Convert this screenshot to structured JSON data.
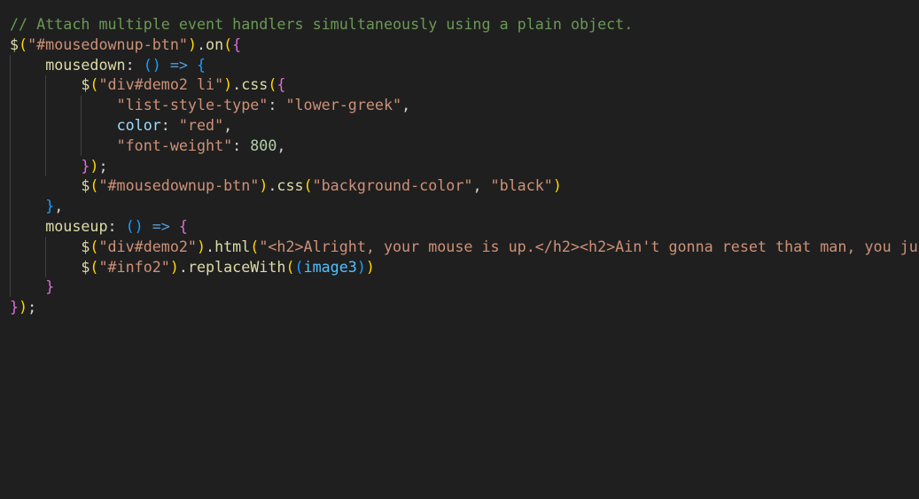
{
  "editor": {
    "theme": "dark",
    "colors": {
      "background": "#1f1f1f",
      "comment": "#6a9955",
      "function": "#dcdcaa",
      "string": "#ce9178",
      "property": "#9cdcfe",
      "variable": "#4fc1ff",
      "number": "#b5cea8",
      "keyword": "#569cd6",
      "bracket_level_1": "#ffd700",
      "bracket_level_2": "#da70d6",
      "bracket_level_3": "#179fff"
    },
    "lines": [
      {
        "indent": "",
        "tokens": [
          {
            "t": "// Attach multiple event handlers simultaneously using a plain object.",
            "c": "c-comment"
          }
        ]
      },
      {
        "indent": "",
        "tokens": [
          {
            "t": "$",
            "c": "c-fn"
          },
          {
            "t": "(",
            "c": "b1"
          },
          {
            "t": "\"#mousedownup-btn\"",
            "c": "c-str"
          },
          {
            "t": ")",
            "c": "b1"
          },
          {
            "t": ".",
            "c": "c-punc"
          },
          {
            "t": "on",
            "c": "c-fn"
          },
          {
            "t": "(",
            "c": "b1"
          },
          {
            "t": "{",
            "c": "b2"
          }
        ]
      },
      {
        "indent": "    ",
        "tokens": [
          {
            "t": "mousedown",
            "c": "c-fn"
          },
          {
            "t": ": ",
            "c": "c-punc"
          },
          {
            "t": "()",
            "c": "b3"
          },
          {
            "t": " ",
            "c": "c-punc"
          },
          {
            "t": "=>",
            "c": "c-kw"
          },
          {
            "t": " ",
            "c": "c-punc"
          },
          {
            "t": "{",
            "c": "b3"
          }
        ]
      },
      {
        "indent": "        ",
        "tokens": [
          {
            "t": "$",
            "c": "c-fn"
          },
          {
            "t": "(",
            "c": "b1"
          },
          {
            "t": "\"div#demo2 li\"",
            "c": "c-str"
          },
          {
            "t": ")",
            "c": "b1"
          },
          {
            "t": ".",
            "c": "c-punc"
          },
          {
            "t": "css",
            "c": "c-fn"
          },
          {
            "t": "(",
            "c": "b1"
          },
          {
            "t": "{",
            "c": "b2"
          }
        ]
      },
      {
        "indent": "            ",
        "tokens": [
          {
            "t": "\"list-style-type\"",
            "c": "c-str"
          },
          {
            "t": ": ",
            "c": "c-punc"
          },
          {
            "t": "\"lower-greek\"",
            "c": "c-str"
          },
          {
            "t": ",",
            "c": "c-punc"
          }
        ]
      },
      {
        "indent": "            ",
        "tokens": [
          {
            "t": "color",
            "c": "c-prop"
          },
          {
            "t": ": ",
            "c": "c-punc"
          },
          {
            "t": "\"red\"",
            "c": "c-str"
          },
          {
            "t": ",",
            "c": "c-punc"
          }
        ]
      },
      {
        "indent": "            ",
        "tokens": [
          {
            "t": "\"font-weight\"",
            "c": "c-str"
          },
          {
            "t": ": ",
            "c": "c-punc"
          },
          {
            "t": "800",
            "c": "c-num"
          },
          {
            "t": ",",
            "c": "c-punc"
          }
        ]
      },
      {
        "indent": "        ",
        "tokens": [
          {
            "t": "}",
            "c": "b2"
          },
          {
            "t": ")",
            "c": "b1"
          },
          {
            "t": ";",
            "c": "c-punc"
          }
        ]
      },
      {
        "indent": "        ",
        "tokens": [
          {
            "t": "$",
            "c": "c-fn"
          },
          {
            "t": "(",
            "c": "b1"
          },
          {
            "t": "\"#mousedownup-btn\"",
            "c": "c-str"
          },
          {
            "t": ")",
            "c": "b1"
          },
          {
            "t": ".",
            "c": "c-punc"
          },
          {
            "t": "css",
            "c": "c-fn"
          },
          {
            "t": "(",
            "c": "b1"
          },
          {
            "t": "\"background-color\"",
            "c": "c-str"
          },
          {
            "t": ", ",
            "c": "c-punc"
          },
          {
            "t": "\"black\"",
            "c": "c-str"
          },
          {
            "t": ")",
            "c": "b1"
          }
        ]
      },
      {
        "indent": "    ",
        "tokens": [
          {
            "t": "}",
            "c": "b3"
          },
          {
            "t": ",",
            "c": "c-punc"
          }
        ]
      },
      {
        "indent": "    ",
        "tokens": [
          {
            "t": "mouseup",
            "c": "c-fn"
          },
          {
            "t": ": ",
            "c": "c-punc"
          },
          {
            "t": "()",
            "c": "b3"
          },
          {
            "t": " ",
            "c": "c-punc"
          },
          {
            "t": "=>",
            "c": "c-kw"
          },
          {
            "t": " ",
            "c": "c-punc"
          },
          {
            "t": "{",
            "c": "b2"
          }
        ]
      },
      {
        "indent": "        ",
        "tokens": [
          {
            "t": "$",
            "c": "c-fn"
          },
          {
            "t": "(",
            "c": "b1"
          },
          {
            "t": "\"div#demo2\"",
            "c": "c-str"
          },
          {
            "t": ")",
            "c": "b1"
          },
          {
            "t": ".",
            "c": "c-punc"
          },
          {
            "t": "html",
            "c": "c-fn"
          },
          {
            "t": "(",
            "c": "b1"
          },
          {
            "t": "\"<h2>Alright, your mouse is up.</h2><h2>Ain't gonna reset that man, you ju",
            "c": "c-str"
          }
        ]
      },
      {
        "indent": "        ",
        "tokens": [
          {
            "t": "$",
            "c": "c-fn"
          },
          {
            "t": "(",
            "c": "b1"
          },
          {
            "t": "\"#info2\"",
            "c": "c-str"
          },
          {
            "t": ")",
            "c": "b1"
          },
          {
            "t": ".",
            "c": "c-punc"
          },
          {
            "t": "replaceWith",
            "c": "c-fn"
          },
          {
            "t": "(",
            "c": "b1"
          },
          {
            "t": "(",
            "c": "b3"
          },
          {
            "t": "image3",
            "c": "c-var"
          },
          {
            "t": ")",
            "c": "b3"
          },
          {
            "t": ")",
            "c": "b1"
          }
        ]
      },
      {
        "indent": "    ",
        "tokens": [
          {
            "t": "}",
            "c": "b2"
          }
        ]
      },
      {
        "indent": "",
        "tokens": [
          {
            "t": "}",
            "c": "b2"
          },
          {
            "t": ")",
            "c": "b1"
          },
          {
            "t": ";",
            "c": "c-punc"
          }
        ]
      }
    ]
  }
}
